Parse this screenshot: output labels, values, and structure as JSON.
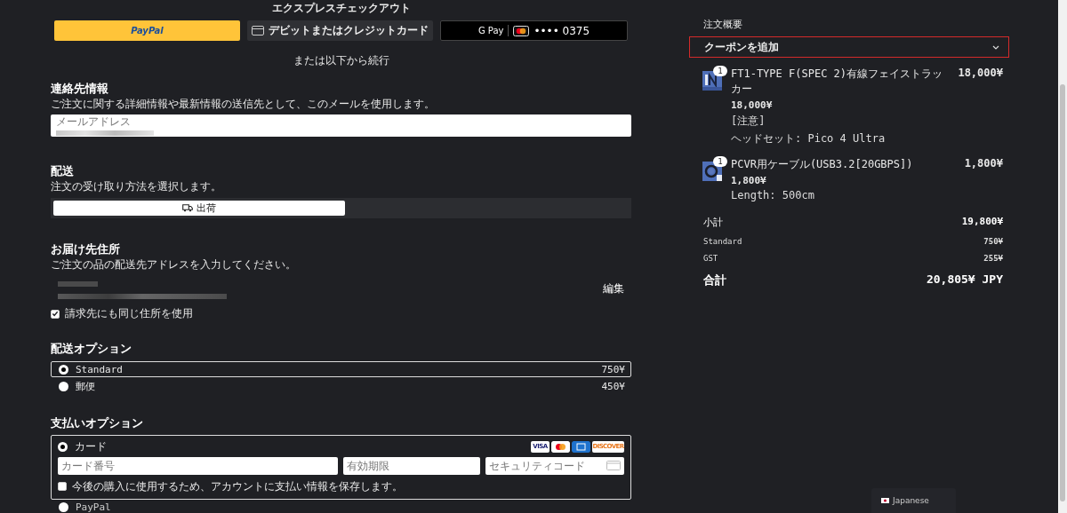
{
  "express_checkout": {
    "title": "エクスプレスチェックアウト",
    "buttons": [
      {
        "kind": "paypal",
        "label": "PayPal"
      },
      {
        "kind": "card",
        "label": "デビットまたはクレジットカード"
      },
      {
        "kind": "gpay",
        "label": "G Pay",
        "card_number": "•••• 0375"
      }
    ],
    "divider_text": "または以下から続行"
  },
  "contact": {
    "heading": "連絡先情報",
    "description": "ご注文に関する詳細情報や最新情報の送信先として、このメールを使用します。",
    "email_field": {
      "label": "メールアドレス"
    }
  },
  "delivery": {
    "heading": "配送",
    "description": "注文の受け取り方法を選択します。",
    "methods": [
      {
        "label": "出荷",
        "selected": true
      }
    ]
  },
  "shipping_address": {
    "heading": "お届け先住所",
    "description": "ご注文の品の配送先アドレスを入力してください。",
    "edit_link": "編集",
    "same_billing": {
      "label": "請求先にも同じ住所を使用",
      "checked": true
    }
  },
  "shipping_options": {
    "heading": "配送オプション",
    "options": [
      {
        "label": "Standard",
        "price": "750¥",
        "selected": true
      },
      {
        "label": "郵便",
        "price": "450¥",
        "selected": false
      }
    ]
  },
  "payment": {
    "heading": "支払いオプション",
    "options": [
      {
        "label": "カード",
        "selected": true
      },
      {
        "label": "PayPal",
        "selected": false
      }
    ],
    "card_brands": [
      {
        "kind": "visa",
        "label": "VISA"
      },
      {
        "kind": "mastercard"
      },
      {
        "kind": "amex"
      },
      {
        "kind": "discover",
        "label": "DISCOVER"
      }
    ],
    "fields": [
      {
        "placeholder": "カード番号"
      },
      {
        "placeholder": "有効期限"
      },
      {
        "placeholder": "セキュリティコード"
      }
    ],
    "save_info": {
      "label": "今後の購入に使用するため、アカウントに支払い情報を保存します。",
      "checked": false
    }
  },
  "order_summary": {
    "title": "注文概要",
    "coupon": {
      "label": "クーポンを追加",
      "expanded": false
    },
    "items": [
      {
        "quantity": "1",
        "name": "FT1-TYPE F(SPEC 2)有線フェイストラッカー",
        "price": "18,000¥",
        "unit_price": "18,000¥",
        "details": [
          "[注意]",
          "ヘッドセット: Pico 4 Ultra"
        ]
      },
      {
        "quantity": "1",
        "name": "PCVR用ケーブル(USB3.2[20GBPS])",
        "price": "1,800¥",
        "unit_price": "1,800¥",
        "details": [
          "Length: 500cm"
        ]
      }
    ],
    "lines": [
      {
        "label": "小計",
        "value": "19,800¥",
        "kind": "bold"
      },
      {
        "label": "Standard",
        "value": "750¥",
        "kind": "plain"
      },
      {
        "label": "GST",
        "value": "255¥",
        "kind": "plain"
      }
    ],
    "total": {
      "label": "合計",
      "value": "20,805¥ JPY"
    }
  },
  "language": {
    "label": "Japanese"
  }
}
